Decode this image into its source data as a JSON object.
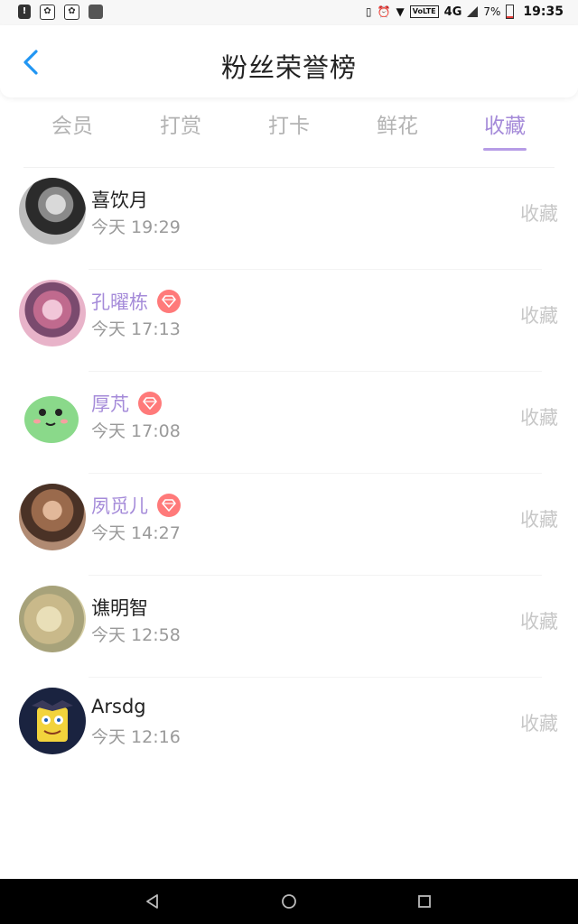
{
  "status_bar": {
    "battery_text": "7%",
    "network": "4G",
    "volte": "VoLTE",
    "time": "19:35"
  },
  "header": {
    "title": "粉丝荣誉榜"
  },
  "tabs": [
    {
      "label": "会员",
      "active": false
    },
    {
      "label": "打赏",
      "active": false
    },
    {
      "label": "打卡",
      "active": false
    },
    {
      "label": "鲜花",
      "active": false
    },
    {
      "label": "收藏",
      "active": true
    }
  ],
  "fans": [
    {
      "name": "喜饮月",
      "time": "今天 19:29",
      "action": "收藏",
      "vip": false
    },
    {
      "name": "孔曜栋",
      "time": "今天 17:13",
      "action": "收藏",
      "vip": true
    },
    {
      "name": "厚芃",
      "time": "今天 17:08",
      "action": "收藏",
      "vip": true
    },
    {
      "name": "夙觅儿",
      "time": "今天 14:27",
      "action": "收藏",
      "vip": true
    },
    {
      "name": "谯明智",
      "time": "今天 12:58",
      "action": "收藏",
      "vip": false
    },
    {
      "name": "Arsdg",
      "time": "今天 12:16",
      "action": "收藏",
      "vip": false
    }
  ],
  "colors": {
    "accent": "#a58bd9",
    "tab_inactive": "#b3b3b3",
    "vip_badge": "#ff7a7a",
    "back_arrow": "#2196f3"
  },
  "icons": {
    "back": "chevron-left-icon",
    "vip": "diamond-icon",
    "nav_back": "triangle-back-icon",
    "nav_home": "circle-home-icon",
    "nav_recent": "square-recent-icon"
  }
}
